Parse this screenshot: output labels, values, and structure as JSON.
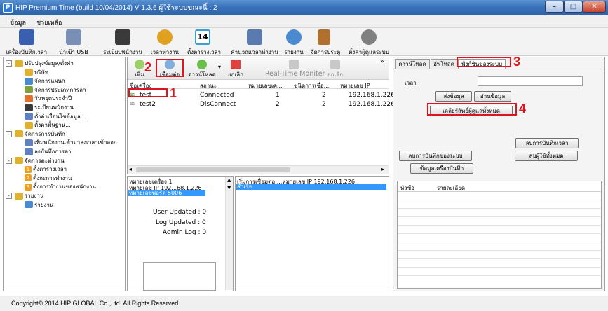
{
  "window": {
    "title": "HIP Premium Time (build 10/04/2014) V 1.3.6   ผู้ใช้ระบบขณะนี้  : 2",
    "min_icon": "minimize-icon",
    "max_icon": "maximize-icon",
    "close_icon": "close-icon"
  },
  "menu": [
    "ข้อมูล",
    "ช่วยเหลือ"
  ],
  "toolbar": [
    {
      "label": "เครื่องบันทึกเวลา",
      "icon": "clock-device-icon",
      "color": "#3a5fb0"
    },
    {
      "label": "นำเข้า USB",
      "icon": "usb-icon",
      "color": "#7a8fb5"
    },
    {
      "label": "ระเบียบพนักงาน",
      "icon": "employees-icon",
      "color": "#3a3a3a"
    },
    {
      "label": "เวลาทำงาน",
      "icon": "alarm-clock-icon",
      "color": "#e0a020"
    },
    {
      "label": "ตั้งตารางเวลา",
      "icon": "calendar-icon",
      "color": "#3aa0d0"
    },
    {
      "label": "คำนวณเวลาทำงาน",
      "icon": "calculate-icon",
      "color": "#5a7ab0"
    },
    {
      "label": "รายงาน",
      "icon": "report-icon",
      "color": "#4a8ad0"
    },
    {
      "label": "จัดการประตู",
      "icon": "door-icon",
      "color": "#b07030"
    },
    {
      "label": "ตั้งค่าผู้ดูแลระบบ",
      "icon": "admin-settings-icon",
      "color": "#808080"
    }
  ],
  "tree": [
    {
      "label": "ปรับปรุงข้อมูล/ตั้งค่า",
      "level": 0,
      "expand": "-",
      "color": "#e0b030"
    },
    {
      "label": "บริษัท",
      "level": 1,
      "color": "#e0b030"
    },
    {
      "label": "จัดการแผนก",
      "level": 1,
      "color": "#4a8ad0"
    },
    {
      "label": "จัดการประเภทการลา",
      "level": 1,
      "color": "#80a040"
    },
    {
      "label": "วันหยุดประจำปี",
      "level": 1,
      "color": "#e07030"
    },
    {
      "label": "ระเบียนพนักงาน",
      "level": 1,
      "color": "#3a3a3a"
    },
    {
      "label": "ตั้งค่าเงื่อนไขข้อมูล...",
      "level": 1,
      "color": "#6080c0"
    },
    {
      "label": "ตั้งค่าพื้นฐาน...",
      "level": 1,
      "color": "#e0b030"
    },
    {
      "label": "จัดการการบันทึก",
      "level": 0,
      "expand": "-",
      "color": "#e0b030"
    },
    {
      "label": "เพิ่มพนักงานเข้ามาลงเวลาเข้าออก",
      "level": 1,
      "color": "#6080c0"
    },
    {
      "label": "ลงบันทึกการลา",
      "level": 1,
      "color": "#6080c0"
    },
    {
      "label": "จัดการตะทำงาน",
      "level": 0,
      "expand": "-",
      "color": "#e0b030"
    },
    {
      "label": "ตั้งตารางเวลา",
      "level": 1,
      "badge": "1",
      "color": "#f0a020"
    },
    {
      "label": "ตั้งกะการทำงาน",
      "level": 1,
      "badge": "2",
      "color": "#f0a020"
    },
    {
      "label": "ตั้งการทำงานของพนักงาน",
      "level": 1,
      "badge": "3",
      "color": "#f0a020"
    },
    {
      "label": "รายงาน",
      "level": 0,
      "expand": "-",
      "color": "#e0b030"
    },
    {
      "label": "รายงาน",
      "level": 1,
      "color": "#4a8ad0"
    }
  ],
  "device_toolbar": {
    "items": [
      "เพิ่ม",
      "เชื่อมต่อ",
      "ดาวน์โหลด",
      "ยกเลิก"
    ],
    "realtime": "Real-Time Moniter",
    "realtime_cancel": "ยกเลิก",
    "more": "»"
  },
  "devices": {
    "columns": [
      "ชื่อเครื่อง",
      "สถานะ",
      "หมายเลขเค...",
      "ชนิดการเชื่อ...",
      "หมายเลข IP"
    ],
    "rows": [
      [
        "test",
        "Connected",
        "1",
        "2",
        "192.168.1.226"
      ],
      [
        "test2",
        "DisConnect",
        "2",
        "2",
        "192.168.1.226"
      ]
    ]
  },
  "info_left": {
    "lines": [
      "หมายเลขเครื่อง  1",
      "หมายเลข IP   192.168.1.226",
      "หมายเลขพอร์ต  5006"
    ],
    "user_updated": "User Updated :  0",
    "log_updated": "Log Updated :  0",
    "admin_log": "Admin Log :  0"
  },
  "info_mid": {
    "lines": [
      "เริ่มการเชื่อมต่อ....หมายเลข IP   192.168.1.226",
      "สำเร็จ"
    ]
  },
  "right": {
    "tabs": [
      "ดาวน์โหลด",
      "อัพโหลด",
      "ฟังก์ชันของระบบ"
    ],
    "time_label": "เวลา",
    "send_btn": "ส่งข้อมูล",
    "read_btn": "อ่านข้อมูล",
    "clear_btn": "เคลียร์สิทธิ์ผู้ดูแลทั้งหมด",
    "del_time_btn": "ลบการบันทึกเวลา",
    "del_sys_btn": "ลบการบันทึกของระบบ",
    "del_users_btn": "ลบผู้ใช้ทั้งหมด",
    "device_info_btn": "ข้อมูลเครื่องบันทึก",
    "list_cols": [
      "หัวข้อ",
      "รายละเอียด"
    ]
  },
  "annotations": [
    "1",
    "2",
    "3",
    "4"
  ],
  "status": "Copyright© 2014 HIP GLOBAL Co.,Ltd. All Rights Reserved",
  "colors": {
    "annotation_red": "#e0141e",
    "selection_blue": "#3399ff"
  }
}
